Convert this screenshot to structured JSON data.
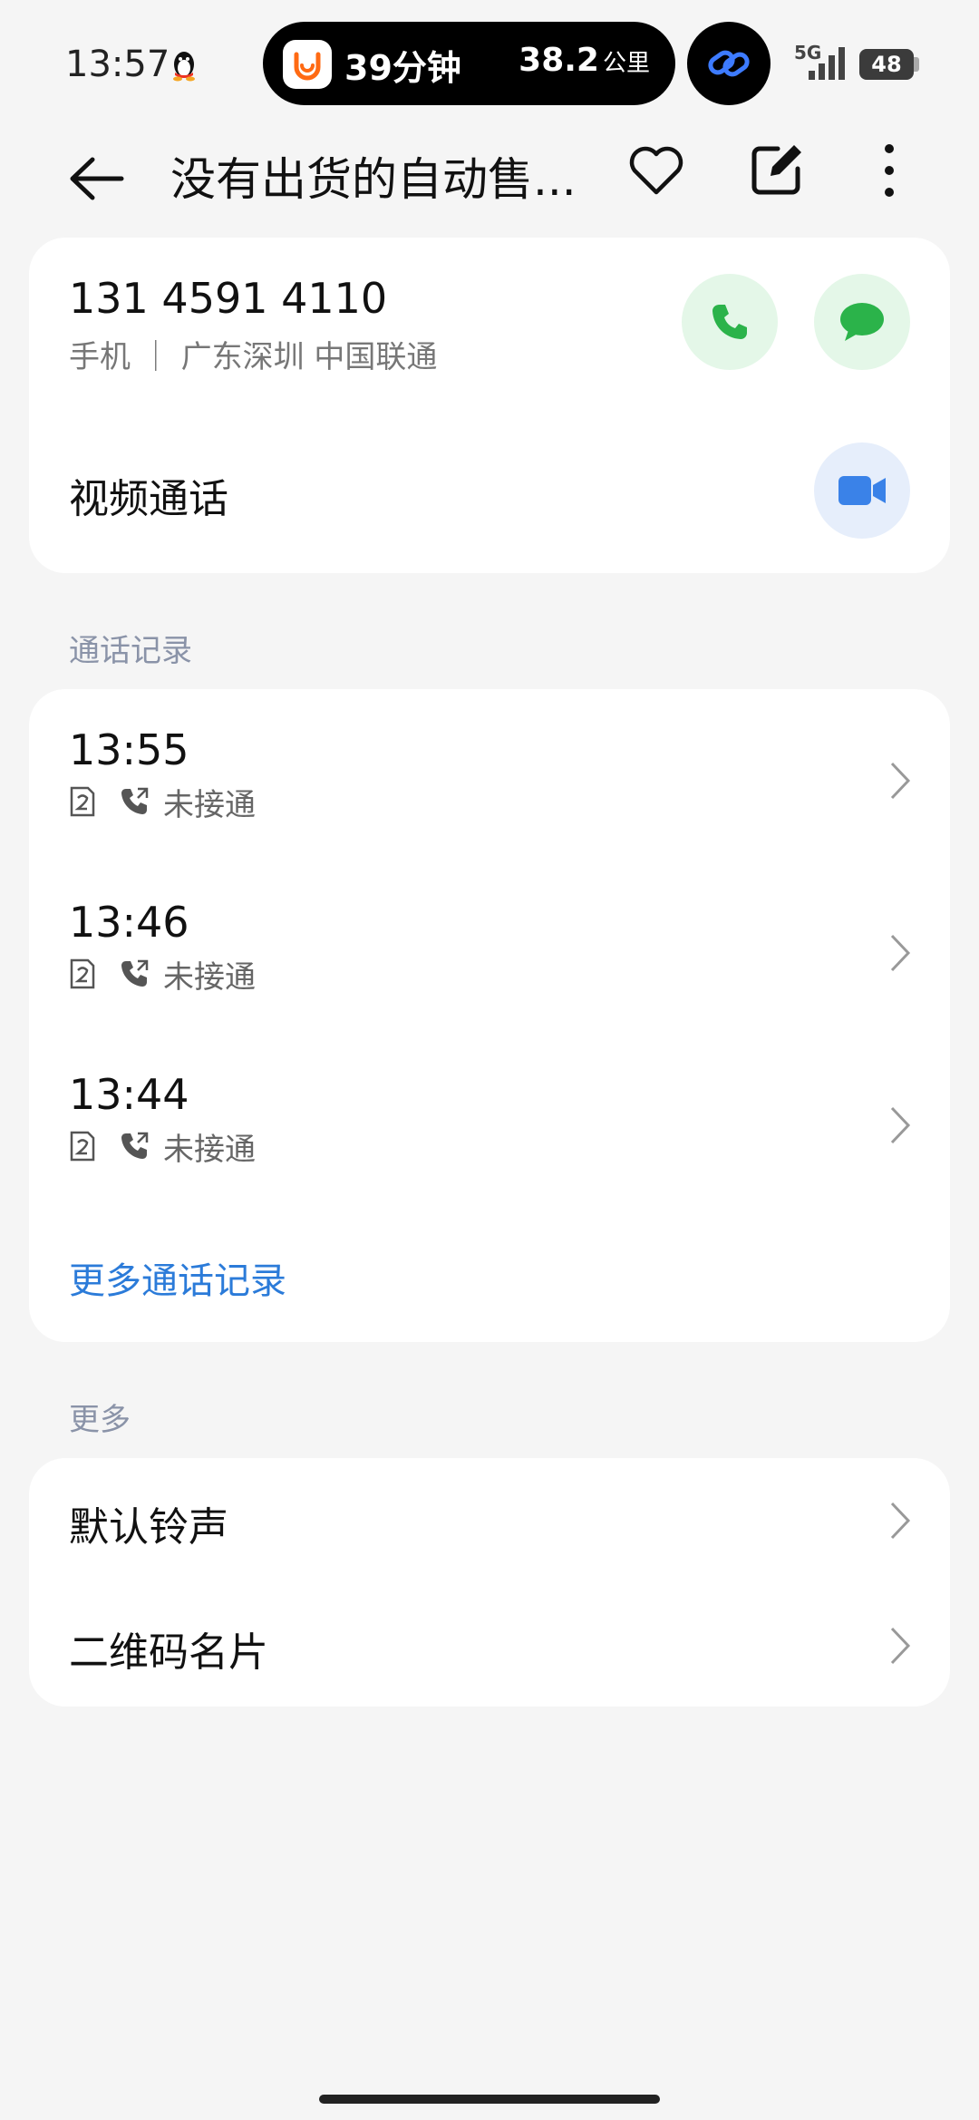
{
  "status_bar": {
    "time": "13:57",
    "ride_minutes": "39分钟",
    "ride_distance": "38.2",
    "ride_distance_unit": "公里",
    "network": "5G",
    "battery": "48"
  },
  "header": {
    "title": "没有出货的自动售..."
  },
  "contact": {
    "phone_number": "131 4591 4110",
    "phone_meta": "手机 ｜ 广东深圳 中国联通",
    "video_call_label": "视频通话"
  },
  "call_log": {
    "section_title": "通话记录",
    "entries": [
      {
        "time": "13:55",
        "status": "未接通"
      },
      {
        "time": "13:46",
        "status": "未接通"
      },
      {
        "time": "13:44",
        "status": "未接通"
      }
    ],
    "more_link": "更多通话记录"
  },
  "more": {
    "section_title": "更多",
    "items": [
      {
        "label": "默认铃声"
      },
      {
        "label": "二维码名片"
      }
    ]
  },
  "colors": {
    "accent_blue": "#2b7bd9",
    "call_green": "#2bb34a",
    "video_blue": "#3a82e8"
  }
}
